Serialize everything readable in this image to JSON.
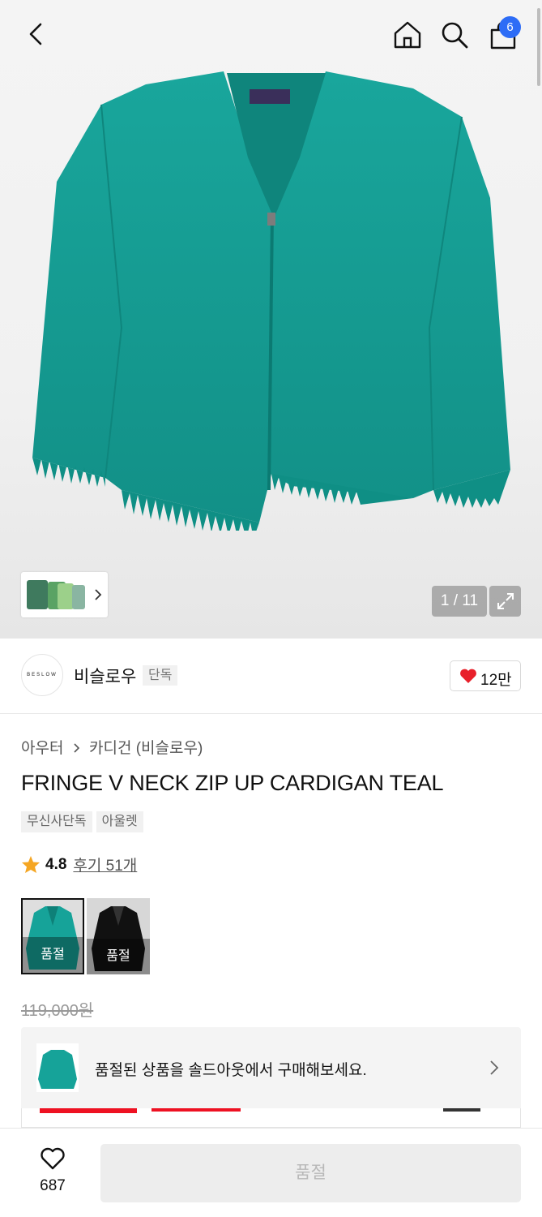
{
  "app": {
    "cart_count": "6"
  },
  "gallery": {
    "pager": "1 / 11"
  },
  "brand": {
    "logo_text": "BESLOW",
    "name": "비슬로우",
    "tag": "단독",
    "likes": "12만"
  },
  "product": {
    "category_parent": "아우터",
    "category_child": "카디건 (비슬로우)",
    "title": "FRINGE V NECK ZIP UP CARDIGAN TEAL",
    "tags": [
      "무신사단독",
      "아울렛"
    ],
    "rating": "4.8",
    "reviews": "후기 51개",
    "original_price": "119,000원"
  },
  "swatches": [
    {
      "color": "teal",
      "status": "품절"
    },
    {
      "color": "black",
      "status": "품절"
    }
  ],
  "soldout_banner": {
    "message": "품절된 상품을 솔드아웃에서 구매해보세요."
  },
  "bottom": {
    "wishlist_count": "687",
    "buy_label": "품절"
  },
  "colors": {
    "accent_blue": "#2d6cf6",
    "heart_red": "#e8202a",
    "star": "#f5a623",
    "product_teal": "#16a399"
  }
}
